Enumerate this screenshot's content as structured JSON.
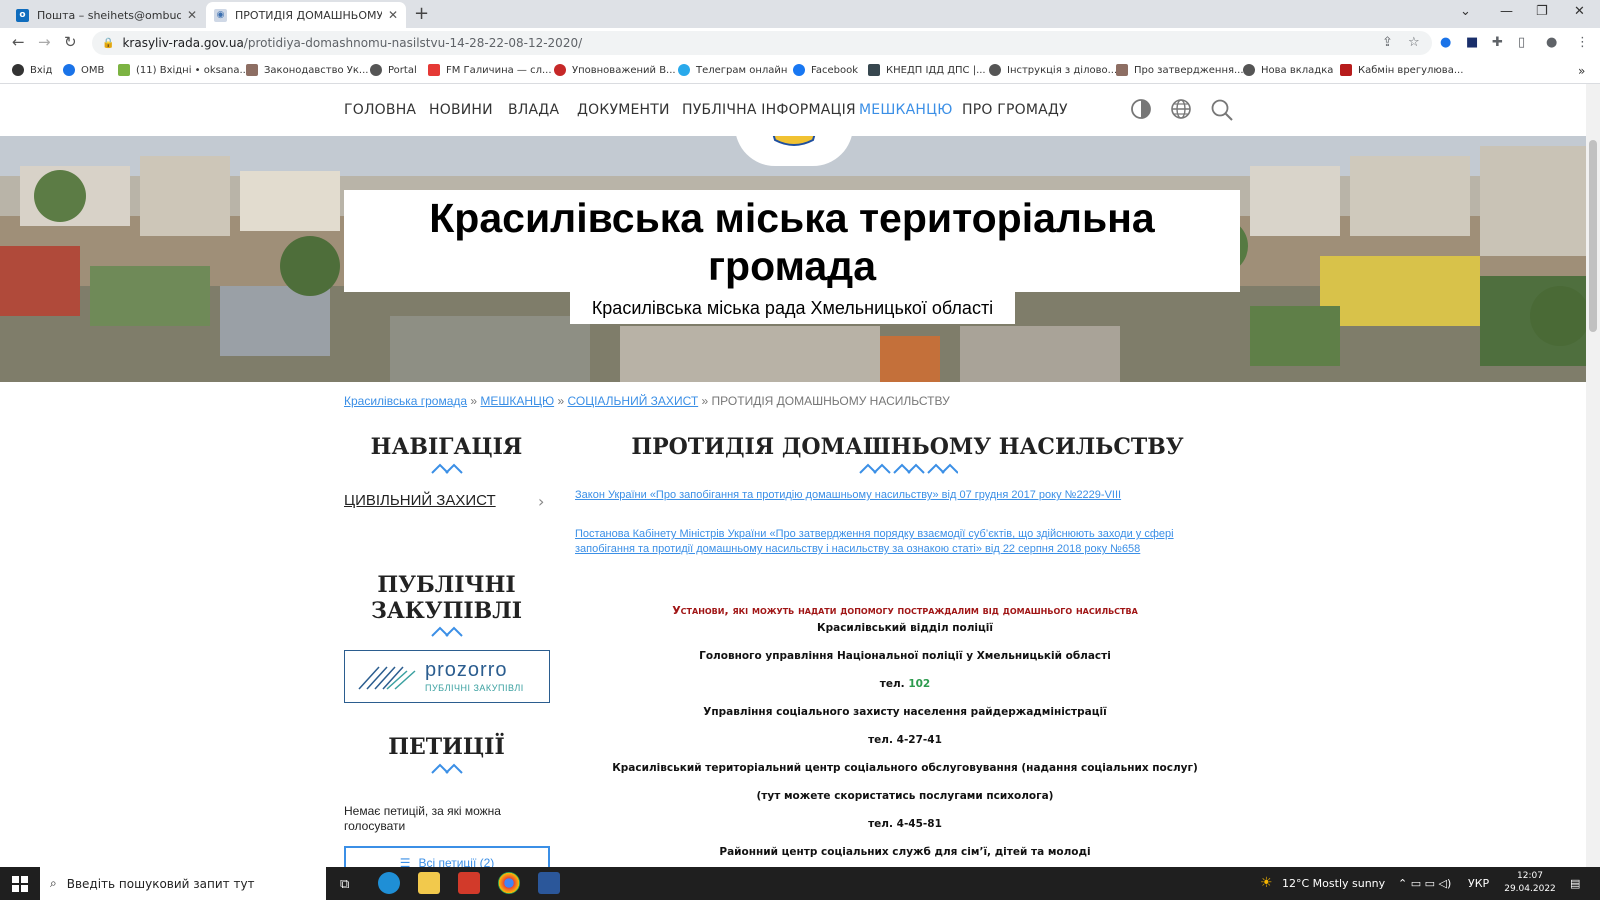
{
  "browser": {
    "tabs": [
      {
        "title": "Пошта – sheihets@ombudsman"
      },
      {
        "title": "ПРОТИДІЯ ДОМАШНЬОМУ НА"
      }
    ],
    "url_host": "krasyliv-rada.gov.ua",
    "url_path": "/protidiya-domashnomu-nasilstvu-14-28-22-08-12-2020/",
    "bookmarks": [
      "Вхід",
      "OMB",
      "(11) Вхідні • oksana...",
      "Законодавство Ук...",
      "Portal",
      "FM Галичина — сл...",
      "Уповноважений В...",
      "Телеграм онлайн",
      "Facebook",
      "КНЕДП ІДД ДПС |...",
      "Інструкція з ділово...",
      "Про затвердження...",
      "Нова вкладка",
      "Кабмін врегулюва..."
    ],
    "colors": {
      "tabstrip": "#dee1e6",
      "link": "#3b8fe6"
    }
  },
  "site_nav": {
    "items": [
      "ГОЛОВНА",
      "НОВИНИ",
      "ВЛАДА",
      "ДОКУМЕНТИ",
      "ПУБЛІЧНА ІНФОРМАЦІЯ",
      "МЕШКАНЦЮ",
      "ПРО ГРОМАДУ"
    ],
    "active_item": "МЕШКАНЦЮ",
    "icons": [
      "contrast-icon",
      "globe-icon",
      "search-icon"
    ]
  },
  "hero": {
    "title": "Красилівська міська територіальна громада",
    "subtitle": "Красилівська міська рада Хмельницької області"
  },
  "breadcrumb": {
    "links": [
      "Красилівська громада",
      "МЕШКАНЦЮ",
      "СОЦІАЛЬНИЙ ЗАХИСТ"
    ],
    "separator": "»",
    "current": "ПРОТИДІЯ ДОМАШНЬОМУ НАСИЛЬСТВУ"
  },
  "sidebar": {
    "navigation_title": "НАВІГАЦІЯ",
    "navigation_link": "ЦИВІЛЬНИЙ ЗАХИСТ",
    "procurement_title": "ПУБЛІЧНІ ЗАКУПІВЛІ",
    "prozorro_logo": "prozorro",
    "prozorro_sub": "ПУБЛІЧНІ ЗАКУПІВЛІ",
    "petitions_title": "ПЕТИЦІЇ",
    "petitions_text": "Немає петицій, за які можна голосувати",
    "petitions_button": "Всі петиції (2)"
  },
  "main": {
    "title": "ПРОТИДІЯ ДОМАШНЬОМУ НАСИЛЬСТВУ",
    "link1": "Закон України «Про запобігання та протидію домашньому насильству» від 07 грудня 2017 року №2229-VIII",
    "link2": "Постанова Кабінету Міністрів України «Про затвердження порядку взаємодії суб’єктів, що здійснюють заходи у сфері запобігання та протидії домашньому насильству і насильству за ознакою статі» від 22 серпня 2018 року №658",
    "section_title": "Установи, які можуть надати допомогу постраждалим від домашнього насильства",
    "lines": {
      "police": "Красилівський відділ поліції",
      "police_main": "Головного управління Національної поліції у Хмельницькій області",
      "tel_prefix": "тел.",
      "police_tel": "102",
      "social": "Управління соціального захисту населення райдержадміністрації",
      "social_tel": "тел. 4-27-41",
      "center": "Красилівський територіальний центр соціального обслуговування (надання соціальних послуг)",
      "psych": "(тут можете скористатись послугами психолога)",
      "center_tel": "тел. 4-45-81",
      "family": "Районний центр соціальних служб для сім’ї, дітей та молоді"
    }
  },
  "taskbar": {
    "search_placeholder": "Введіть пошуковий запит тут",
    "weather": "12°C  Mostly sunny",
    "lang": "УКР",
    "time": "12:07",
    "date": "29.04.2022"
  }
}
